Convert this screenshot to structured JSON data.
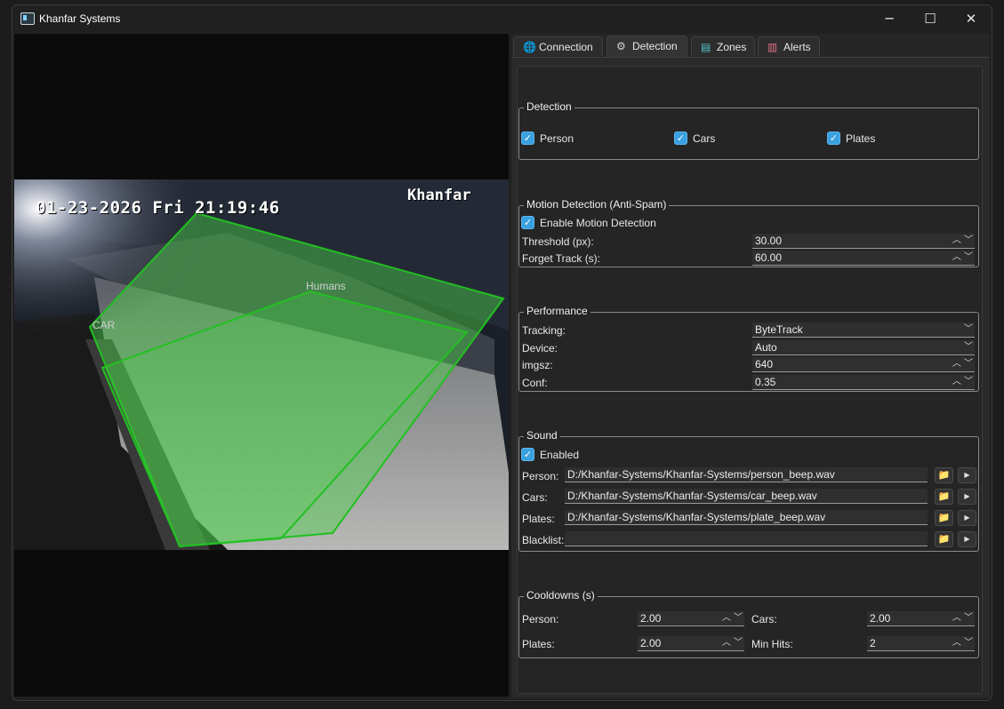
{
  "window": {
    "title": "Khanfar Systems",
    "minimize": "─",
    "maximize": "☐",
    "close": "✕"
  },
  "video": {
    "osd_time": "01-23-2026 Fri 21:19:46",
    "osd_brand": "Khanfar",
    "zones": [
      {
        "label": "CAR"
      },
      {
        "label": "Humans"
      }
    ],
    "zone_color": "#22c022"
  },
  "tabs": [
    {
      "label": "Connection",
      "icon": "globe-icon",
      "glyph": "🌐",
      "active": false
    },
    {
      "label": "Detection",
      "icon": "gear-icon",
      "glyph": "⚙",
      "active": true
    },
    {
      "label": "Zones",
      "icon": "map-icon",
      "glyph": "▤",
      "active": false
    },
    {
      "label": "Alerts",
      "icon": "chart-icon",
      "glyph": "▥",
      "active": false
    }
  ],
  "detection": {
    "title": "Detection",
    "person": {
      "label": "Person",
      "checked": true
    },
    "cars": {
      "label": "Cars",
      "checked": true
    },
    "plates": {
      "label": "Plates",
      "checked": true
    }
  },
  "motion": {
    "title": "Motion Detection (Anti-Spam)",
    "enable_label": "Enable Motion Detection",
    "threshold_label": "Threshold (px):",
    "threshold_value": "30.00",
    "forget_label": "Forget Track (s):",
    "forget_value": "60.00"
  },
  "performance": {
    "title": "Performance",
    "tracking_label": "Tracking:",
    "tracking_value": "ByteTrack",
    "device_label": "Device:",
    "device_value": "Auto",
    "imgsz_label": "imgsz:",
    "imgsz_value": "640",
    "conf_label": "Conf:",
    "conf_value": "0.35"
  },
  "sound": {
    "title": "Sound",
    "enabled_label": "Enabled",
    "person_label": "Person:",
    "person_path": "D:/Khanfar-Systems/Khanfar-Systems/person_beep.wav",
    "cars_label": "Cars:",
    "cars_path": "D:/Khanfar-Systems/Khanfar-Systems/car_beep.wav",
    "plates_label": "Plates:",
    "plates_path": "D:/Khanfar-Systems/Khanfar-Systems/plate_beep.wav",
    "blacklist_label": "Blacklist:",
    "blacklist_path": ""
  },
  "cooldowns": {
    "title": "Cooldowns (s)",
    "person_label": "Person:",
    "person_value": "2.00",
    "cars_label": "Cars:",
    "cars_value": "2.00",
    "plates_label": "Plates:",
    "plates_value": "2.00",
    "minhits_label": "Min Hits:",
    "minhits_value": "2"
  },
  "glyphs": {
    "check": "✓",
    "spin": "︿ ﹀",
    "dropdown": "﹀",
    "folder": "📁",
    "play": "▶"
  }
}
